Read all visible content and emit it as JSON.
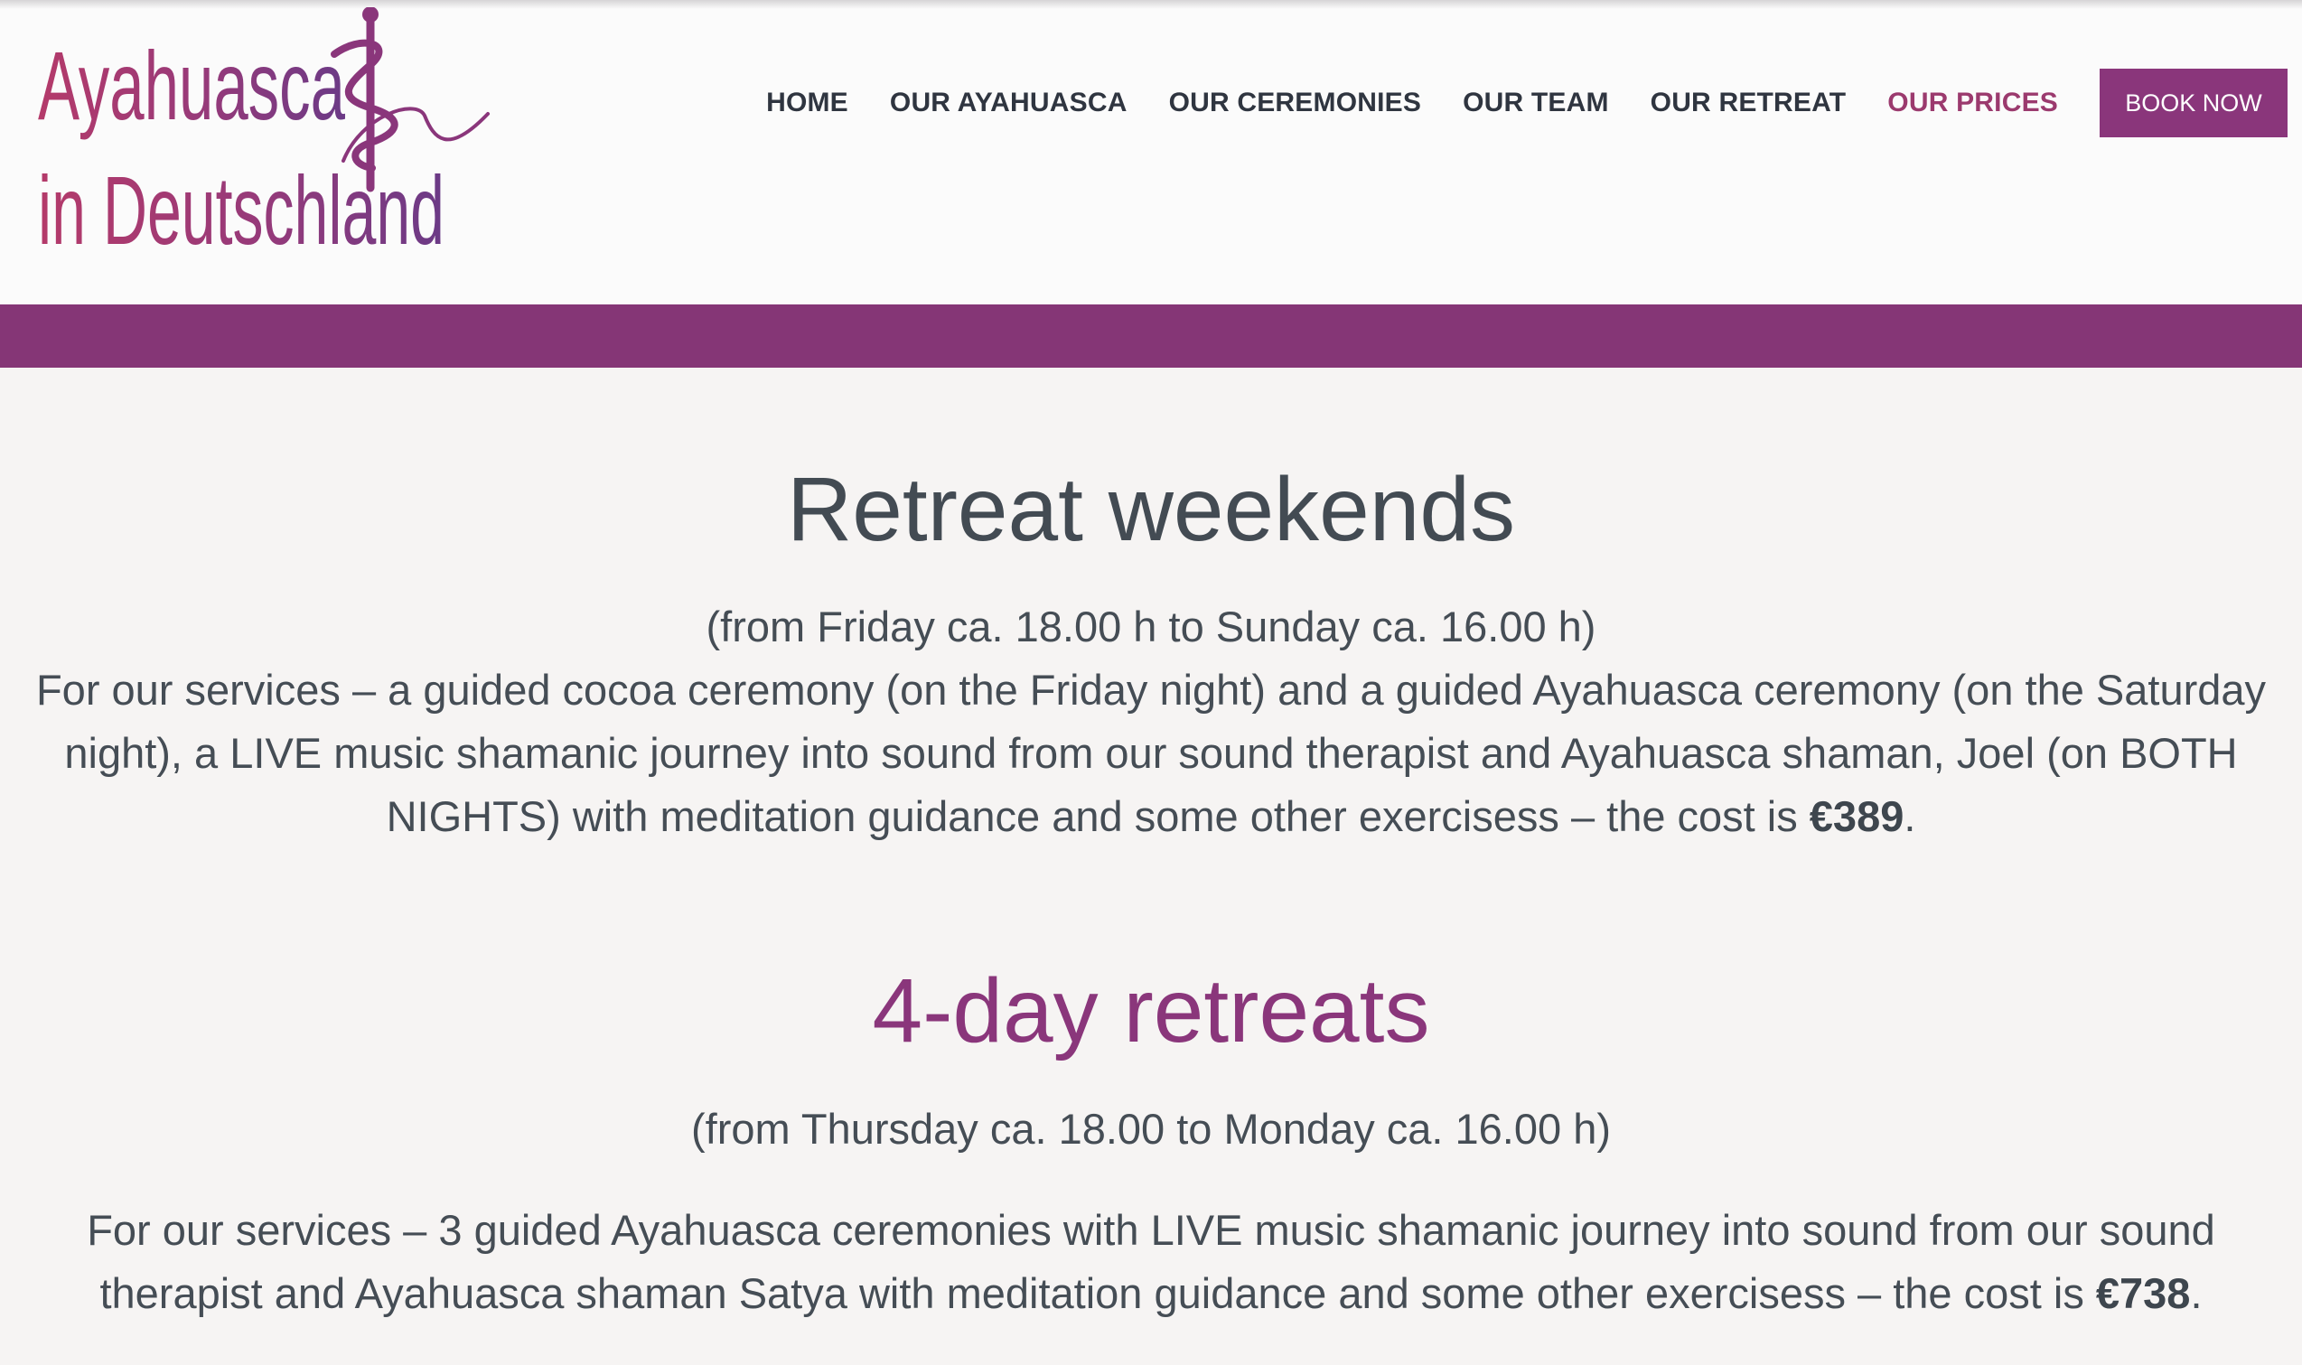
{
  "logo": {
    "line1": "Ayahuasca",
    "line2": "in Deutschland",
    "icon": "rod-of-asclepius-icon"
  },
  "nav": {
    "items": [
      {
        "label": "HOME"
      },
      {
        "label": "OUR AYAHUASCA"
      },
      {
        "label": "OUR CEREMONIES"
      },
      {
        "label": "OUR TEAM"
      },
      {
        "label": "OUR RETREAT"
      },
      {
        "label": "OUR PRICES",
        "active": true
      }
    ],
    "cta": "BOOK NOW"
  },
  "colors": {
    "accent": "#8a367b",
    "band": "#853676",
    "active_nav": "#9b3a6e",
    "heading": "#434b53",
    "background": "#f6f4f3"
  },
  "weekend": {
    "title": "Retreat weekends",
    "timeframe": "(from Friday ca. 18.00 h to Sunday ca. 16.00 h)",
    "description": "For our services – a guided cocoa ceremony (on the Friday night) and a guided Ayahuasca ceremony (on the Saturday night), a LIVE music shamanic journey into sound from our sound therapist and Ayahuasca shaman, Joel (on BOTH NIGHTS) with meditation guidance and some other exercisess – the cost is ",
    "price": "€389",
    "end": "."
  },
  "fourday": {
    "title": "4-day retreats",
    "timeframe": "(from Thursday ca. 18.00 to Monday ca. 16.00 h)",
    "description": "For our services – 3 guided Ayahuasca ceremonies with LIVE music shamanic journey into sound from our sound therapist and Ayahuasca shaman Satya with meditation guidance and some other exercisess – the cost is ",
    "price": "€738",
    "end": "."
  }
}
